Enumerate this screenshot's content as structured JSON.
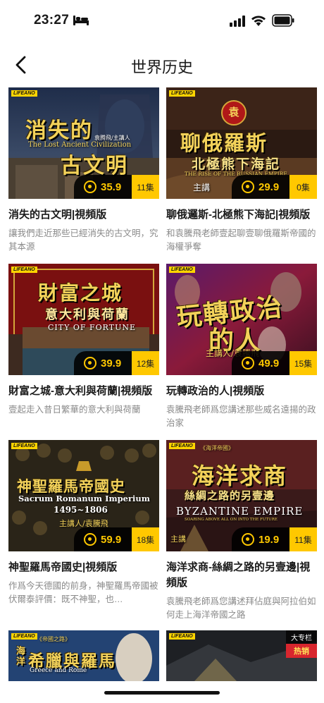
{
  "status_bar": {
    "time": "23:27"
  },
  "header": {
    "title": "世界历史"
  },
  "brand_logo": "LIFEANO",
  "courses": [
    {
      "cover_title_line1": "消失的",
      "cover_title_line2": "古文明",
      "cover_subtitle_en": "The Lost Ancient Civilization",
      "cover_credit": "袁腾飛/主講人",
      "price": "35.9",
      "episodes": "11集",
      "title": "消失的古文明|視頻版",
      "description": "讓我們走近那些已經消失的古文明，究其本源"
    },
    {
      "cover_emblem": "袁",
      "cover_title_line1": "聊俄羅斯",
      "cover_title_line2": "北極熊下海記",
      "cover_subtitle_en": "THE RISE OF THE RUSSIAN EMPIRE",
      "cover_credit": "主講",
      "price": "29.9",
      "episodes": "0集",
      "title": "聊俄邏斯-北極熊下海記|視頻版",
      "description": "和袁騰飛老師壹起聊壹聊俄羅斯帝國的海權爭奪"
    },
    {
      "cover_title_line1": "財富之城",
      "cover_title_line2": "意大利與荷蘭",
      "cover_subtitle_en": "CITY OF FORTUNE",
      "price": "39.9",
      "episodes": "12集",
      "title": "財富之城-意大利與荷蘭|視頻版",
      "description": "壹起走入昔日繁華的意大利與荷蘭"
    },
    {
      "cover_title_line1": "玩轉政治",
      "cover_title_line2": "的人",
      "cover_credit": "主講人/袁騰飛",
      "price": "49.9",
      "episodes": "15集",
      "title": "玩轉政治的人|視頻版",
      "description": "袁騰飛老師爲您講述那些威名遠揚的政治家"
    },
    {
      "cover_title_line1": "神聖羅馬帝國史",
      "cover_subtitle_en": "Sacrum Romanum Imperium",
      "cover_years": "1495~1806",
      "cover_credit": "主講人/袁騰飛",
      "price": "59.9",
      "episodes": "18集",
      "title": "神聖羅馬帝國史|視頻版",
      "description": "作爲今天德國的前身，神聖羅馬帝國被伏爾泰評價：既不神聖，也…"
    },
    {
      "cover_tag": "《海洋帝國》",
      "cover_title_line1": "海洋求商",
      "cover_title_line2": "絲綢之路的另壹邊",
      "cover_subtitle_en": "BYZANTINE EMPIRE",
      "cover_subtitle_en2": "SOARING ABOVE ALL ON INTO THE FUTURE",
      "cover_credit": "主講",
      "price": "19.9",
      "episodes": "11集",
      "title": "海洋求商-絲綢之路的另壹邊|視頻版",
      "description": "袁騰飛老師爲您講述拜佔庭與阿拉伯如何走上海洋帝國之路"
    },
    {
      "cover_tag": "《帝國之路》",
      "cover_title_line1": "希臘與羅馬",
      "cover_side": "海洋",
      "cover_subtitle_en": "Greece and Rome"
    },
    {
      "promo_top": "大专栏",
      "promo_bottom": "热销"
    }
  ],
  "colors": {
    "accent": "#ffc800",
    "desc": "#8a8a8a"
  }
}
